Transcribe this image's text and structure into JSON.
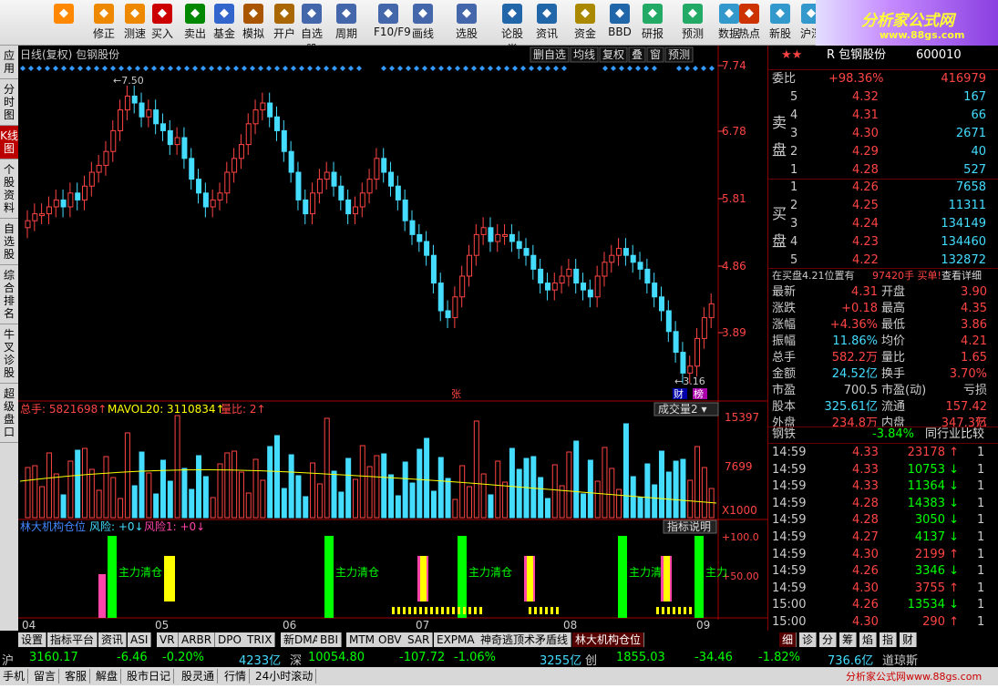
{
  "toolbar": {
    "buttons": [
      {
        "label": "",
        "icon": "back-icon"
      },
      {
        "label": "修正",
        "icon": "refresh-icon"
      },
      {
        "label": "测速",
        "icon": "clock-icon"
      },
      {
        "label": "买入",
        "icon": "buy-icon"
      },
      {
        "label": "卖出",
        "icon": "sell-icon"
      },
      {
        "label": "基金",
        "icon": "fund-icon"
      },
      {
        "label": "模拟",
        "icon": "hammer-icon"
      },
      {
        "label": "开户",
        "icon": "lock-icon"
      },
      {
        "label": "自选股",
        "icon": "star-icon"
      },
      {
        "label": "周期",
        "icon": "period-icon"
      },
      {
        "label": "F10/F9",
        "icon": "f10-icon"
      },
      {
        "label": "画线",
        "icon": "pen-icon"
      },
      {
        "label": "选股",
        "icon": "select-icon"
      },
      {
        "label": "论股堂",
        "icon": "forum-icon"
      },
      {
        "label": "资讯",
        "icon": "news-icon"
      },
      {
        "label": "资金",
        "icon": "money-icon"
      },
      {
        "label": "BBD",
        "icon": "bbd-icon"
      },
      {
        "label": "研报",
        "icon": "report-icon"
      },
      {
        "label": "预测",
        "icon": "forecast-icon"
      },
      {
        "label": "数据",
        "icon": "data-icon"
      },
      {
        "label": "热点",
        "icon": "hot-icon"
      },
      {
        "label": "新股",
        "icon": "newstock-icon"
      },
      {
        "label": "沪深",
        "icon": "market-icon"
      }
    ],
    "logo": {
      "title": "分析家公式网",
      "url": "www.88gs.com"
    }
  },
  "sidebar": [
    "应用",
    "分时图",
    "K线图",
    "个股资料",
    "自选股",
    "综合排名",
    "牛叉诊股",
    "超级盘口"
  ],
  "chart": {
    "header": "日线(复权)  包钢股份",
    "buttons": [
      "删自选",
      "均线",
      "复权",
      "叠",
      "窗",
      "预测"
    ],
    "price_axis": [
      "7.74",
      "6.78",
      "5.81",
      "4.86",
      "3.89"
    ],
    "high_label": "7.50",
    "low_label": "3.16",
    "tags": [
      "财",
      "榜"
    ],
    "zhang": "张",
    "vol": {
      "total": "总手: 5821698",
      "ma20": "MAVOL20: 3110834",
      "ratio": "量比: 2",
      "select": "成交量2",
      "axis": [
        "15397",
        "7699",
        "X1000"
      ]
    },
    "ind": {
      "name": "林大机构仓位",
      "r0": "风险: +0",
      "r1": "风险1: +0",
      "btn": "指标说明",
      "axis": [
        "+100.0",
        "+50.00"
      ],
      "labels": [
        "主力清仓",
        "主力清仓",
        "主力清仓",
        "主力清",
        "主力"
      ]
    },
    "xlabels": [
      "04",
      "05",
      "06",
      "07",
      "08",
      "09"
    ],
    "chart_data": {
      "type": "candlestick",
      "y_range": [
        3.16,
        7.74
      ],
      "closes": [
        5.5,
        5.6,
        5.6,
        5.7,
        5.8,
        5.7,
        5.9,
        5.8,
        6.0,
        6.2,
        6.3,
        6.5,
        6.8,
        7.1,
        7.3,
        7.2,
        7.0,
        7.1,
        6.9,
        6.8,
        6.6,
        6.7,
        6.4,
        6.1,
        5.9,
        5.7,
        5.8,
        5.9,
        6.2,
        6.4,
        6.6,
        6.9,
        7.1,
        7.2,
        7.0,
        6.8,
        6.5,
        6.2,
        5.8,
        5.6,
        5.9,
        6.1,
        6.2,
        6.0,
        5.8,
        5.6,
        5.7,
        5.9,
        6.1,
        6.4,
        6.2,
        6.0,
        5.8,
        5.5,
        5.3,
        5.2,
        5.0,
        4.6,
        4.2,
        4.1,
        4.4,
        4.7,
        5.0,
        5.3,
        5.4,
        5.2,
        5.3,
        5.3,
        5.2,
        5.1,
        5.0,
        4.8,
        4.6,
        4.5,
        4.6,
        4.7,
        4.8,
        4.6,
        4.5,
        4.4,
        4.7,
        4.9,
        5.0,
        5.1,
        5.0,
        4.9,
        4.8,
        4.6,
        4.4,
        4.2,
        3.9,
        3.6,
        3.3,
        3.4,
        3.8,
        4.1,
        4.3
      ]
    }
  },
  "quote": {
    "name": "包钢股份",
    "code": "600010",
    "prefix": "R",
    "weibi": {
      "label": "委比",
      "pct": "+98.36%",
      "val": "416979"
    },
    "sell": [
      {
        "n": "5",
        "p": "4.32",
        "v": "167"
      },
      {
        "n": "4",
        "p": "4.31",
        "v": "66"
      },
      {
        "n": "3",
        "p": "4.30",
        "v": "2671"
      },
      {
        "n": "2",
        "p": "4.29",
        "v": "40"
      },
      {
        "n": "1",
        "p": "4.28",
        "v": "527"
      }
    ],
    "buy": [
      {
        "n": "1",
        "p": "4.26",
        "v": "7658"
      },
      {
        "n": "2",
        "p": "4.25",
        "v": "11311"
      },
      {
        "n": "3",
        "p": "4.24",
        "v": "134149"
      },
      {
        "n": "4",
        "p": "4.23",
        "v": "134460"
      },
      {
        "n": "5",
        "p": "4.22",
        "v": "132872"
      }
    ],
    "sell_label": "卖盘",
    "buy_label": "买盘",
    "note": "在买盘4.21位置有",
    "note_v": "97420手 买单!",
    "note_link": "查看详细",
    "stats": [
      [
        "最新",
        "4.31",
        "开盘",
        "3.90"
      ],
      [
        "涨跌",
        "+0.18",
        "最高",
        "4.35"
      ],
      [
        "涨幅",
        "+4.36%",
        "最低",
        "3.86"
      ],
      [
        "振幅",
        "11.86%",
        "均价",
        "4.21"
      ],
      [
        "总手",
        "582.2万",
        "量比",
        "1.65"
      ],
      [
        "金额",
        "24.52亿",
        "换手",
        "3.70%"
      ],
      [
        "市盈",
        "700.5",
        "市盈(动)",
        "亏损"
      ],
      [
        "股本",
        "325.61亿",
        "流通",
        "157.42亿"
      ],
      [
        "外盘",
        "234.8万",
        "内盘",
        "347.3万"
      ]
    ],
    "industry": {
      "name": "钢铁",
      "pct": "-3.84%",
      "btn": "同行业比较"
    },
    "ticks": [
      [
        "14:59",
        "4.33",
        "23178",
        "1"
      ],
      [
        "14:59",
        "4.33",
        "10753",
        "1"
      ],
      [
        "14:59",
        "4.33",
        "11364",
        "1"
      ],
      [
        "14:59",
        "4.28",
        "14383",
        "1"
      ],
      [
        "14:59",
        "4.28",
        "3050",
        "1"
      ],
      [
        "14:59",
        "4.27",
        "4137",
        "1"
      ],
      [
        "14:59",
        "4.30",
        "2199",
        "1"
      ],
      [
        "14:59",
        "4.26",
        "3346",
        "1"
      ],
      [
        "14:59",
        "4.30",
        "3755",
        "1"
      ],
      [
        "15:00",
        "4.26",
        "13534",
        "1"
      ],
      [
        "15:00",
        "4.30",
        "290",
        "1"
      ]
    ]
  },
  "tabs": [
    "设置",
    "指标平台",
    "资讯",
    "ASI",
    "VR",
    "ARBR",
    "DPO",
    "TRIX",
    "新DMA",
    "BBI",
    "MTM",
    "OBV",
    "SAR",
    "EXPMA",
    "神奇逃顶术矛盾线",
    "林大机构仓位"
  ],
  "rtabs": [
    "细",
    "诊",
    "分",
    "筹",
    "焰",
    "指",
    "财"
  ],
  "status": {
    "sh": "沪",
    "sh_v": "3160.17",
    "sh_c": "-6.46",
    "sh_p": "-0.20%",
    "sh_a": "4233亿",
    "sz": "深",
    "sz_v": "10054.80",
    "sz_c": "-107.72",
    "sz_p": "-1.06%",
    "sz_a": "3255亿",
    "cy": "创",
    "cy_v": "1855.03",
    "cy_c": "-34.46",
    "cy_p": "-1.82%",
    "cy_a": "736.6亿",
    "gq": "道琼斯"
  },
  "status2": [
    "手机",
    "留言",
    "客服",
    "解盘",
    "股市日记",
    "股灵通",
    "行情",
    "24小时滚动"
  ],
  "watermark": "分析家公式网www.88gs.com"
}
